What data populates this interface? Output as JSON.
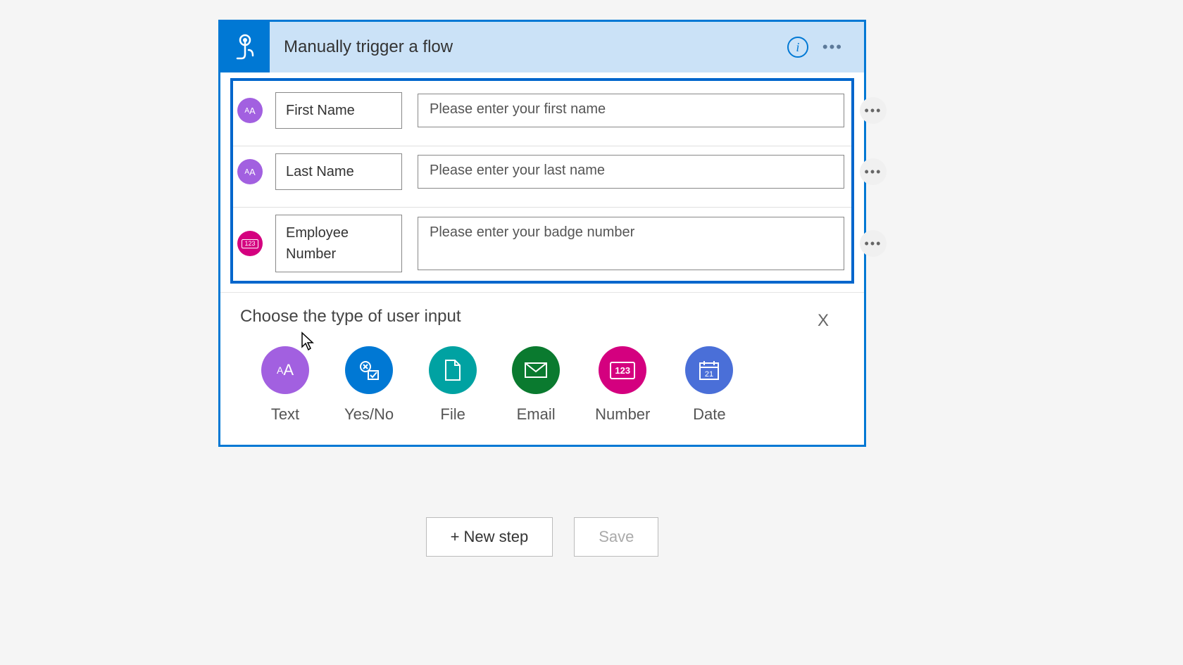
{
  "header": {
    "title": "Manually trigger a flow"
  },
  "inputs": [
    {
      "type": "text",
      "name": "First Name",
      "prompt": "Please enter your first name"
    },
    {
      "type": "text",
      "name": "Last Name",
      "prompt": "Please enter your last name"
    },
    {
      "type": "number",
      "name": "Employee Number",
      "prompt": "Please enter your badge number"
    }
  ],
  "chooser": {
    "title": "Choose the type of user input",
    "close": "X",
    "options": [
      {
        "key": "text",
        "label": "Text"
      },
      {
        "key": "yesno",
        "label": "Yes/No"
      },
      {
        "key": "file",
        "label": "File"
      },
      {
        "key": "email",
        "label": "Email"
      },
      {
        "key": "number",
        "label": "Number"
      },
      {
        "key": "date",
        "label": "Date"
      }
    ]
  },
  "footer": {
    "new_step": "+ New step",
    "save": "Save"
  },
  "icons": {
    "text_glyph": "AA",
    "number_glyph": "123",
    "date_glyph": "21"
  }
}
